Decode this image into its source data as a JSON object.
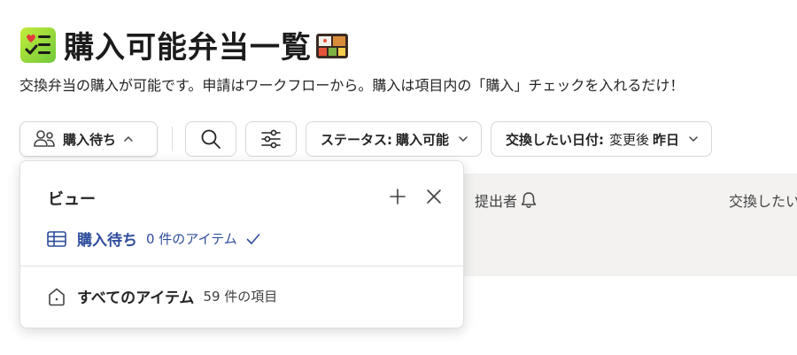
{
  "page": {
    "title": "購入可能弁当一覧",
    "description": "交換弁当の購入が可能です。申請はワークフローから。購入は項目内の「購入」チェックを入れるだけ！"
  },
  "toolbar": {
    "view_button_label": "購入待ち",
    "status_filter": {
      "label": "ステータス:",
      "value": "購入可能"
    },
    "date_filter": {
      "label": "交換したい日付:",
      "value_prefix": "変更後",
      "value": "昨日"
    }
  },
  "list": {
    "columns": [
      "提出者",
      "交換したい日付"
    ]
  },
  "view_panel": {
    "title": "ビュー",
    "views": [
      {
        "name": "購入待ち",
        "count": "0 件のアイテム",
        "active": true
      },
      {
        "name": "すべてのアイテム",
        "count": "59 件の項目",
        "active": false
      }
    ]
  },
  "icons": {
    "page_icon": "checklist-icon",
    "title_decoration": "bento-box-icon",
    "view_button": "people-group-icon",
    "search": "search-icon",
    "filter_settings": "sliders-icon",
    "notification": "bell-icon",
    "add": "plus-icon",
    "close": "close-icon",
    "active_view": "table-grid-icon",
    "all_items_view": "home-icon",
    "selected": "checkmark-icon"
  },
  "colors": {
    "accent": "#2f4d9c",
    "page_icon_bg": "#8fd33a",
    "list_header_bg": "#f3f2f1"
  }
}
